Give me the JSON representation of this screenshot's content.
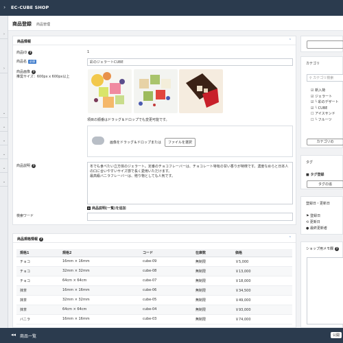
{
  "topbar": {
    "shop_name": "EC-CUBE SHOP"
  },
  "header": {
    "title": "商品登録",
    "subtitle": "商品管理"
  },
  "product_info": {
    "section_title": "商品情報",
    "id_label": "商品ID",
    "id_value": "1",
    "name_label": "商品名",
    "required": "必須",
    "name_value": "彩のジェラートCUBE",
    "image_label": "商品画像",
    "image_size": "推奨サイズ：600px x 600px以上",
    "drag_note": "項目の順番はドラッグ＆ドロップでも変更可能です。",
    "drop_text": "画像をドラッグ＆ドロップまたは",
    "file_button": "ファイルを選択",
    "desc_label": "商品説明",
    "desc_text": "冬でも食べたい立方体のジェラート。定番のチョコフレーバーは、チョコレート特有の甘い香りが特徴です。濃度なめらと日本人の口に合いやすいサイズ感で長く愛用いただけます。\n最高級バニラフレーバーは、贈り物としても人気です。",
    "add_list_desc": "商品説明(一覧)を追加",
    "search_label": "検索ワード"
  },
  "price_info": {
    "section_title": "商品規格情報",
    "columns": [
      "規格1",
      "規格2",
      "コード",
      "在庫数",
      "価格"
    ],
    "rows": [
      [
        "チョコ",
        "16mm × 16mm",
        "cube-09",
        "無制限",
        "￥5,000"
      ],
      [
        "チョコ",
        "32mm × 32mm",
        "cube-08",
        "無制限",
        "￥13,000"
      ],
      [
        "チョコ",
        "64cm × 64cm",
        "cube-07",
        "無制限",
        "￥18,000"
      ],
      [
        "抹茶",
        "16mm × 16mm",
        "cube-06",
        "無制限",
        "￥34,500"
      ],
      [
        "抹茶",
        "32mm × 32mm",
        "cube-05",
        "無制限",
        "￥49,000"
      ],
      [
        "抹茶",
        "64cm × 64cm",
        "cube-04",
        "無制限",
        "￥93,000"
      ],
      [
        "バニラ",
        "16mm × 16mm",
        "cube-03",
        "無制限",
        "￥74,000"
      ]
    ]
  },
  "right": {
    "category_title": "カテゴリ",
    "category_search_placeholder": "カテゴリ検索",
    "categories": [
      "新入荷",
      "ジェラート",
      "└ 彩のデザート",
      "└ CUBE",
      "アイスサンド",
      "└ フルーツ"
    ],
    "category_button": "カテゴリの",
    "tag_title": "タグ",
    "tag_register": "タグ登録",
    "tag_button": "タグの追",
    "date_title": "登録日・更新日",
    "created": "登録日",
    "updated": "更新日",
    "last_updater": "最終更新者",
    "memo_title": "ショップ用メモ欄"
  },
  "bottombar": {
    "back_label": "商品一覧",
    "publish_label": "公開"
  }
}
